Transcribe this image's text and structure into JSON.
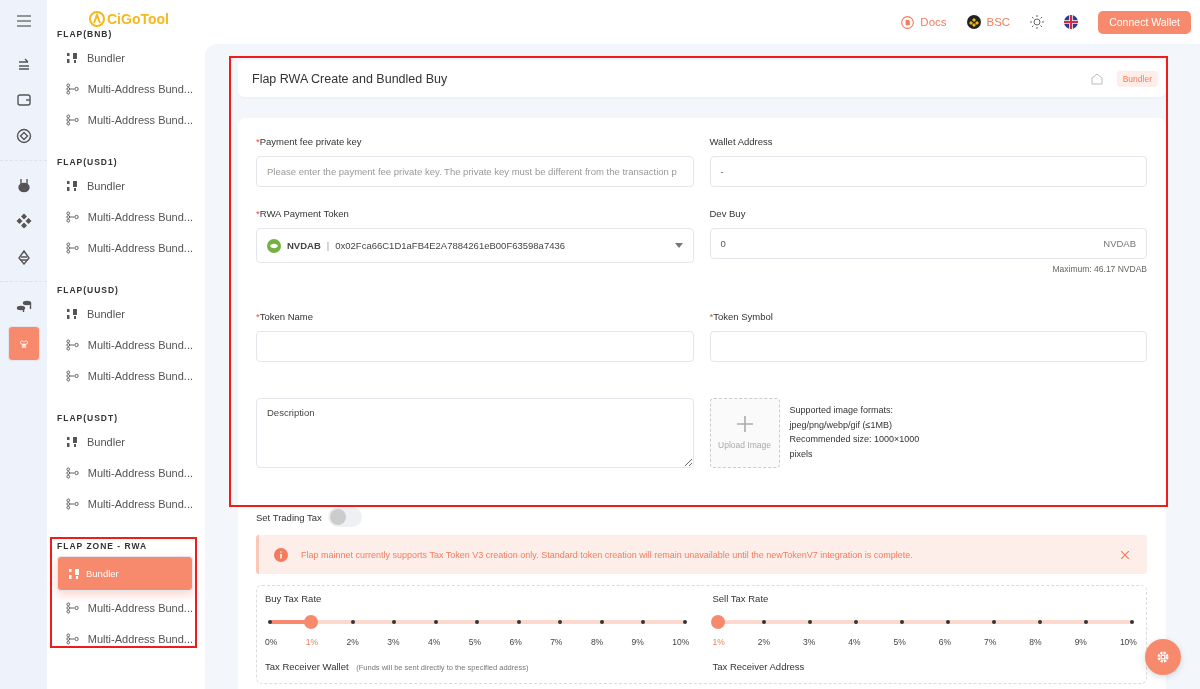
{
  "rail": [
    {
      "kind": "swap",
      "selected": false
    },
    {
      "kind": "wallet",
      "selected": false
    },
    {
      "kind": "diamond",
      "selected": false
    },
    {
      "kind": "rabbit",
      "selected": false
    },
    {
      "kind": "chain",
      "selected": false
    },
    {
      "kind": "pine",
      "selected": false
    },
    {
      "kind": "coins",
      "selected": false
    },
    {
      "kind": "butterfly",
      "selected": true
    }
  ],
  "logo": {
    "text": "CiGoTool"
  },
  "sidebar": [
    {
      "heading": "FLAP(BNB)",
      "items": [
        {
          "kind": "bundler",
          "label": "Bundler",
          "selected": false
        },
        {
          "kind": "multi",
          "label": "Multi-Address Bund...",
          "selected": false
        },
        {
          "kind": "multi",
          "label": "Multi-Address Bund...",
          "selected": false
        }
      ]
    },
    {
      "heading": "FLAP(USD1)",
      "items": [
        {
          "kind": "bundler",
          "label": "Bundler",
          "selected": false
        },
        {
          "kind": "multi",
          "label": "Multi-Address Bund...",
          "selected": false
        },
        {
          "kind": "multi",
          "label": "Multi-Address Bund...",
          "selected": false
        }
      ]
    },
    {
      "heading": "FLAP(UUSD)",
      "items": [
        {
          "kind": "bundler",
          "label": "Bundler",
          "selected": false
        },
        {
          "kind": "multi",
          "label": "Multi-Address Bund...",
          "selected": false
        },
        {
          "kind": "multi",
          "label": "Multi-Address Bund...",
          "selected": false
        }
      ]
    },
    {
      "heading": "FLAP(USDT)",
      "items": [
        {
          "kind": "bundler",
          "label": "Bundler",
          "selected": false
        },
        {
          "kind": "multi",
          "label": "Multi-Address Bund...",
          "selected": false
        },
        {
          "kind": "multi",
          "label": "Multi-Address Bund...",
          "selected": false
        }
      ]
    },
    {
      "heading": "FLAP ZONE - RWA",
      "items": [
        {
          "kind": "bundler",
          "label": "Bundler",
          "selected": true
        },
        {
          "kind": "multi",
          "label": "Multi-Address Bund...",
          "selected": false
        },
        {
          "kind": "multi",
          "label": "Multi-Address Bund...",
          "selected": false
        }
      ]
    }
  ],
  "topbar": {
    "docs": "Docs",
    "network": "BSC",
    "connect": "Connect Wallet"
  },
  "page": {
    "title": "Flap RWA Create and Bundled Buy",
    "tag": "Bundler"
  },
  "form": {
    "required_mark": "*",
    "fee_key": {
      "label": "Payment fee private key",
      "required": true,
      "placeholder": "Please enter the payment fee private key. The private key must be different from the transaction p"
    },
    "wallet": {
      "label": "Wallet Address",
      "required": false,
      "value": "-"
    },
    "token": {
      "label": "RWA Payment Token",
      "required": true,
      "symbol": "NVDAB",
      "separator": "|",
      "address": "0x02Fca66C1D1aFB4E2A7884261eB00F63598a7436"
    },
    "dev_buy": {
      "label": "Dev Buy",
      "required": false,
      "value": "0",
      "unit": "NVDAB",
      "hint": "Maximum: 46.17 NVDAB"
    },
    "name": {
      "label": "Token Name",
      "required": true
    },
    "symbol": {
      "label": "Token Symbol",
      "required": true
    },
    "description": {
      "placeholder": "Description"
    },
    "upload": {
      "label": "Upload Image",
      "notes": [
        "Supported image formats:",
        "jpeg/png/webp/gif (≤1MB)",
        "Recommended size: 1000×1000",
        "pixels"
      ]
    }
  },
  "tax": {
    "label": "Set Trading Tax",
    "on": false,
    "alert": "Flap mainnet currently supports Tax Token V3 creation only. Standard token creation will remain unavailable until the newTokenV7 integration is complete.",
    "buy": {
      "label": "Buy Tax Rate",
      "level": 0.1,
      "marks": [
        {
          "label": "0%",
          "selected": false
        },
        {
          "label": "1%",
          "selected": true
        },
        {
          "label": "2%",
          "selected": false
        },
        {
          "label": "3%",
          "selected": false
        },
        {
          "label": "4%",
          "selected": false
        },
        {
          "label": "5%",
          "selected": false
        },
        {
          "label": "6%",
          "selected": false
        },
        {
          "label": "7%",
          "selected": false
        },
        {
          "label": "8%",
          "selected": false
        },
        {
          "label": "9%",
          "selected": false
        },
        {
          "label": "10%",
          "selected": false
        }
      ]
    },
    "sell": {
      "label": "Sell Tax Rate",
      "level": 0,
      "marks": [
        {
          "label": "1%",
          "selected": true
        },
        {
          "label": "2%",
          "selected": false
        },
        {
          "label": "3%",
          "selected": false
        },
        {
          "label": "4%",
          "selected": false
        },
        {
          "label": "5%",
          "selected": false
        },
        {
          "label": "6%",
          "selected": false
        },
        {
          "label": "7%",
          "selected": false
        },
        {
          "label": "8%",
          "selected": false
        },
        {
          "label": "9%",
          "selected": false
        },
        {
          "label": "10%",
          "selected": false
        }
      ]
    },
    "receiver_wallet": {
      "label": "Tax Receiver Wallet",
      "note": "(Funds will be sent directly to the specified address)"
    },
    "receiver_address": {
      "label": "Tax Receiver Address"
    }
  }
}
